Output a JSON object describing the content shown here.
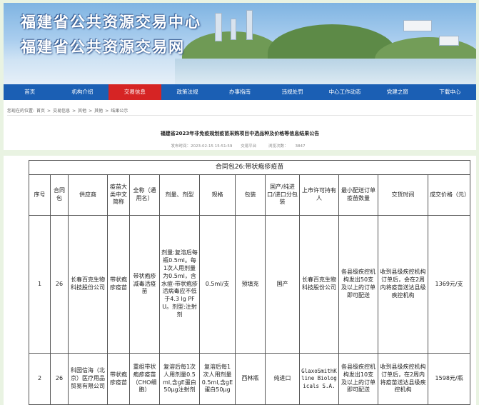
{
  "banner": {
    "title_line1": "福建省公共资源交易中心",
    "title_line2": "福建省公共资源交易网"
  },
  "nav": [
    "首页",
    "机构介绍",
    "交易信息",
    "政策法规",
    "办事指南",
    "违规处罚",
    "中心工作动态",
    "党建之窗",
    "下载中心"
  ],
  "nav_active_index": 2,
  "breadcrumb": [
    "您现在的位置:",
    "首页",
    "交易信息",
    "其他",
    "其他",
    "结果公示"
  ],
  "notice": {
    "title": "福建省2023年非免疫规划疫苗采购项目中选品种及价格等信息结果公告",
    "published": "发布时间：2023-02-15 15:51:59",
    "source": "交易平台",
    "views_label": "浏览次数：",
    "views": "3847"
  },
  "table": {
    "caption": "合同包26:带状疱疹疫苗",
    "headers": [
      "序号",
      "合同包",
      "供应商",
      "疫苗大类中文简称",
      "全称（通用名）",
      "剂量、剂型",
      "规格",
      "包装",
      "国产/纯进口/进口分包装",
      "上市许可持有人",
      "最小配送订单疫苗数量",
      "交货时间",
      "成交价格（元）"
    ],
    "rows": [
      [
        "1",
        "26",
        "长春百克生物科技股份公司",
        "带状疱疹疫苗",
        "带状疱疹减毒活疫苗",
        "剂量:复溶后每瓶0.5ml。每1次人用剂量为0.5ml，含水痘-带状疱疹活病毒应不低于4.3 lg PFU。剂型:注射剂",
        "0.5ml/支",
        "预填充",
        "国产",
        "长春百克生物科技股份公司",
        "各县级疾控机构发出50支及以上的订单即可配送",
        "收到县级疾控机构订单后，会在2周内将疫苗送达县级疾控机构",
        "1369元/支"
      ],
      [
        "2",
        "26",
        "科园信海（北京）医疗用品贸易有限公司",
        "带状疱疹疫苗",
        "重组带状疱疹疫苗（CHO细胞）",
        "复溶后每1次人用剂量0.5ml,含gE蛋白50μg注射剂",
        "复溶后每1次人用剂量0.5ml,含gE蛋白50μg",
        "西林瓶",
        "纯进口",
        "GlaxoSmithKline Biologicals S.A.",
        "各县级疾控机构发出10支及以上的订单即可配送",
        "收到县级疾控机构订单后，在2周内将疫苗送达县级疾控机构",
        "1598元/瓶"
      ]
    ]
  }
}
